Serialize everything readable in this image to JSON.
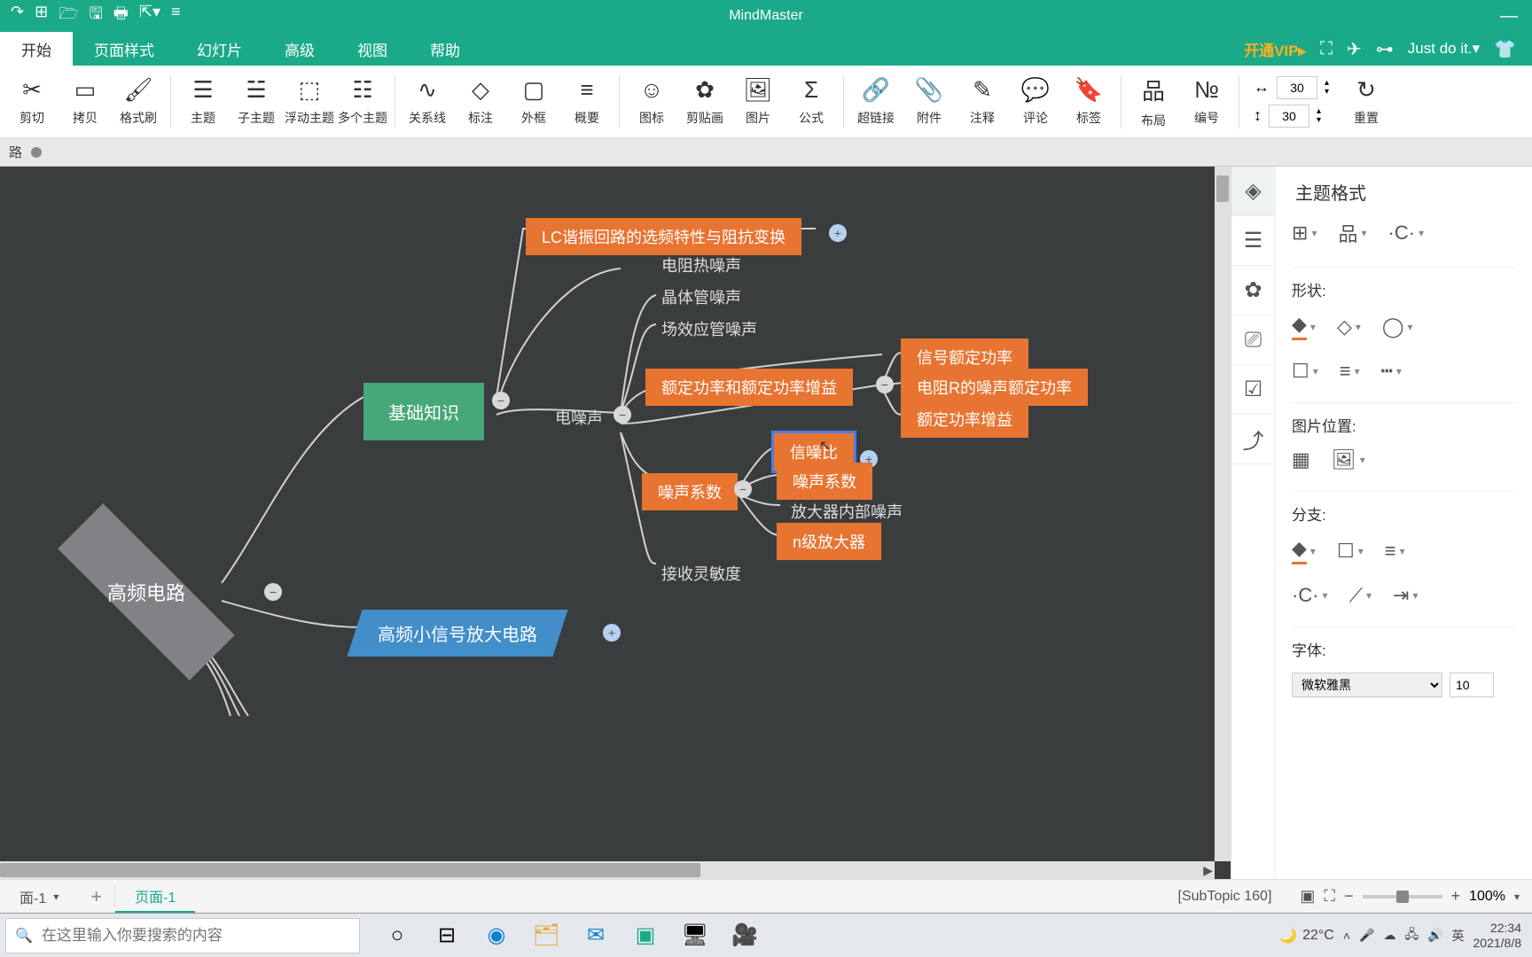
{
  "app_title": "MindMaster",
  "menu": {
    "items": [
      "开始",
      "页面样式",
      "幻灯片",
      "高级",
      "视图",
      "帮助"
    ],
    "active": 0
  },
  "menubar_right": {
    "vip": "开通VIP▸",
    "username": "Just do it.▾"
  },
  "ribbon": {
    "groups": [
      [
        {
          "icon": "✂",
          "label": "剪切"
        },
        {
          "icon": "▭",
          "label": "拷贝"
        },
        {
          "icon": "🖌",
          "label": "格式刷"
        }
      ],
      [
        {
          "icon": "☰",
          "label": "主题"
        },
        {
          "icon": "☱",
          "label": "子主题"
        },
        {
          "icon": "⬚",
          "label": "浮动主题"
        },
        {
          "icon": "☷",
          "label": "多个主题"
        }
      ],
      [
        {
          "icon": "∿",
          "label": "关系线"
        },
        {
          "icon": "◇",
          "label": "标注"
        },
        {
          "icon": "▢",
          "label": "外框"
        },
        {
          "icon": "≡",
          "label": "概要"
        }
      ],
      [
        {
          "icon": "☺",
          "label": "图标"
        },
        {
          "icon": "✿",
          "label": "剪贴画"
        },
        {
          "icon": "🖼",
          "label": "图片"
        },
        {
          "icon": "Σ",
          "label": "公式"
        }
      ],
      [
        {
          "icon": "🔗",
          "label": "超链接"
        },
        {
          "icon": "📎",
          "label": "附件"
        },
        {
          "icon": "✎",
          "label": "注释"
        },
        {
          "icon": "💬",
          "label": "评论"
        },
        {
          "icon": "🔖",
          "label": "标签"
        }
      ],
      [
        {
          "icon": "品",
          "label": "布局"
        },
        {
          "icon": "№",
          "label": "编号"
        }
      ]
    ],
    "spin": {
      "width": "30",
      "height": "30"
    },
    "reset": {
      "icon": "↻",
      "label": "重置"
    }
  },
  "tabrow": {
    "label": "路"
  },
  "mindmap": {
    "root": "高频电路",
    "branch1": "基础知识",
    "branch2": "高频小信号放大电路",
    "n_lc": "LC谐振回路的选频特性与阻抗变换",
    "noise_parent": "电噪声",
    "noise_children": [
      "电阻热噪声",
      "晶体管噪声",
      "场效应管噪声"
    ],
    "rated": "额定功率和额定功率增益",
    "rated_children": [
      "信号额定功率",
      "电阻R的噪声额定功率",
      "额定功率增益"
    ],
    "coeff": "噪声系数",
    "coeff_children": [
      "信噪比",
      "噪声系数",
      "放大器内部噪声",
      "n级放大器"
    ],
    "selected_node": "信噪比",
    "rx": "接收灵敏度"
  },
  "sidepanel": {
    "title": "主题格式",
    "sections": {
      "shape": "形状:",
      "image_pos": "图片位置:",
      "branch": "分支:",
      "font": "字体:"
    },
    "font_name": "微软雅黑",
    "font_size": "10"
  },
  "pagetabs": {
    "tab1": "面-1",
    "tab2": "页面-1"
  },
  "status": {
    "subtopic": "[SubTopic 160]",
    "zoom": "100%"
  },
  "taskbar": {
    "search_placeholder": "在这里输入你要搜索的内容",
    "weather": "22°C",
    "ime": "英",
    "time": "22:34",
    "date": "2021/8/8"
  }
}
